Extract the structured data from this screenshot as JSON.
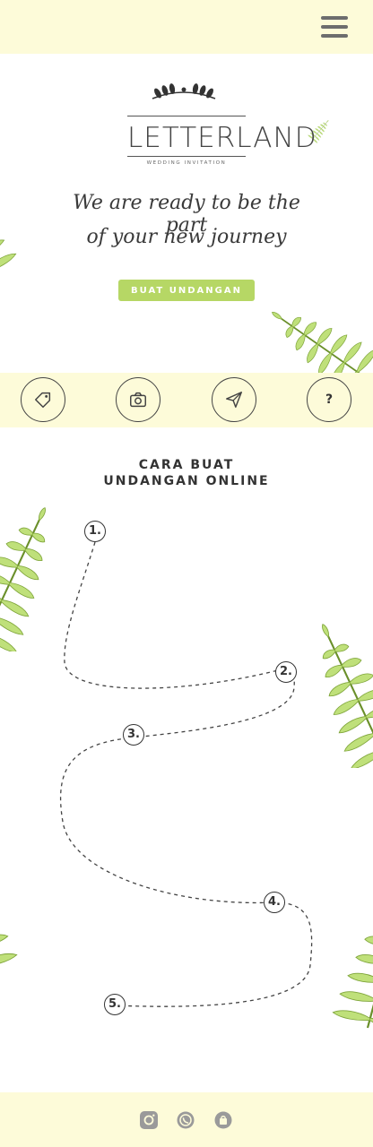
{
  "header": {
    "menu_icon": "hamburger-menu-icon"
  },
  "hero": {
    "logo_text": "LETTERLAND",
    "logo_subtitle": "WEDDING INVITATION",
    "tagline_line1": "We are ready to be the part",
    "tagline_line2": "of your new journey",
    "cta_label": "BUAT UNDANGAN",
    "accent_color": "#b6d765"
  },
  "icon_bar": {
    "items": [
      {
        "icon": "tag-icon"
      },
      {
        "icon": "camera-icon"
      },
      {
        "icon": "paper-plane-icon"
      },
      {
        "icon": "question-icon",
        "label": "?"
      }
    ],
    "background": "#fdfbd9"
  },
  "steps_section": {
    "title_line1": "CARA BUAT",
    "title_line2": "UNDANGAN ONLINE",
    "steps": [
      "1.",
      "2.",
      "3.",
      "4.",
      "5."
    ]
  },
  "footer": {
    "icons": [
      "instagram-icon",
      "whatsapp-icon",
      "shop-bag-icon"
    ]
  }
}
